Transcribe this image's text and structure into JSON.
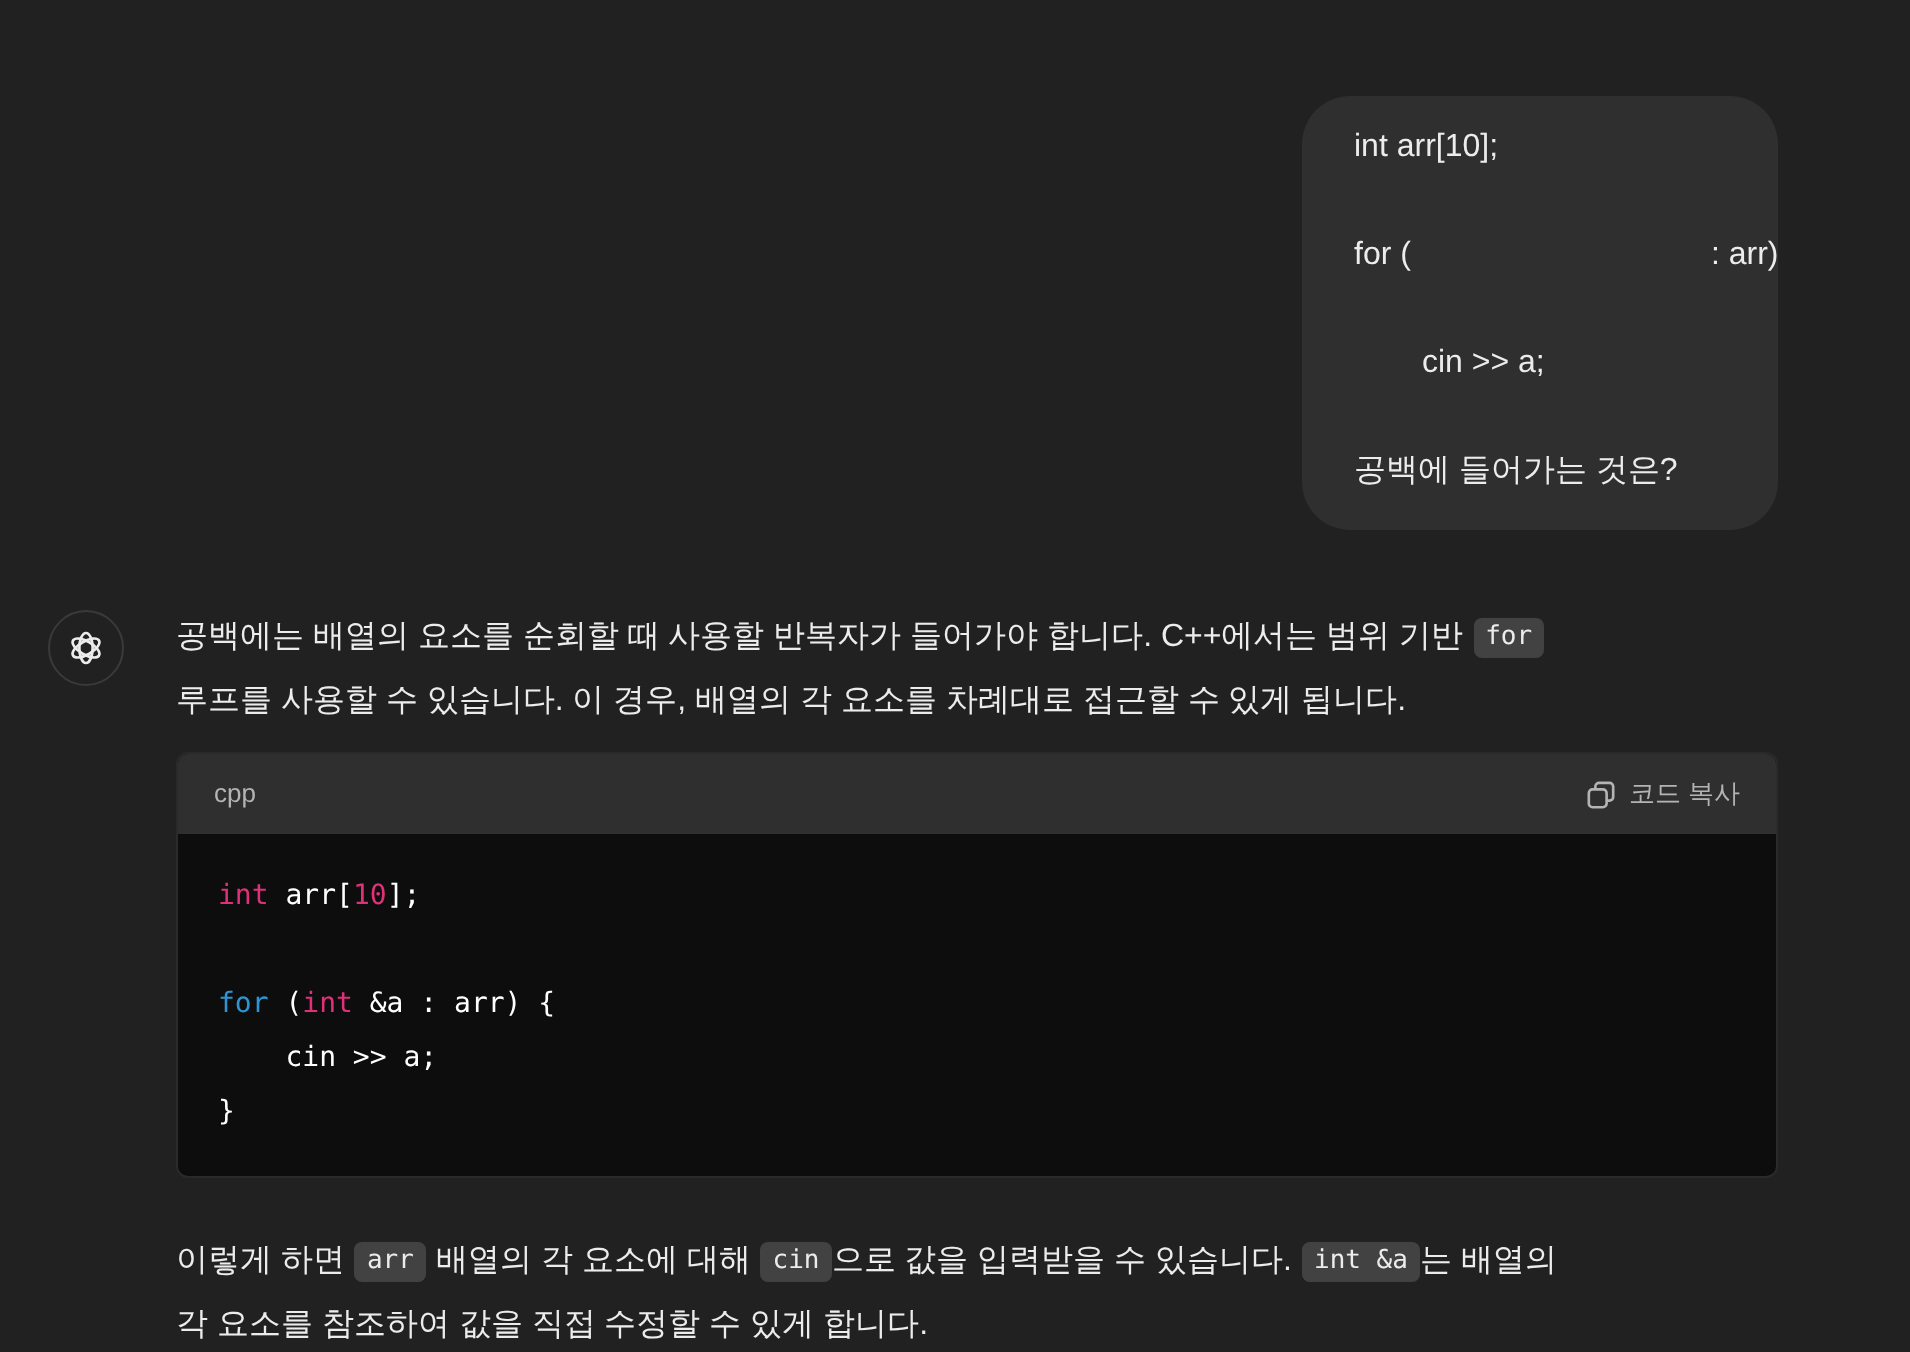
{
  "user_message": {
    "lines": [
      {
        "parts": [
          "int arr[10];"
        ],
        "indented": false
      },
      {
        "parts": [
          "for (",
          ": arr)"
        ],
        "indented": false
      },
      {
        "parts": [
          "cin >> a;"
        ],
        "indented": true
      },
      {
        "parts": [
          "공백에 들어가는 것은?"
        ],
        "indented": false
      }
    ]
  },
  "assistant_message": {
    "paragraphs_before": [
      [
        [
          {
            "kind": "text",
            "text": "공백에는 배열의 요소를 순회할 때 사용할 반복자가 들어가야 합니다. C++에서는 범위 기반"
          },
          {
            "kind": "code",
            "text": "for"
          }
        ],
        [
          {
            "kind": "text",
            "text": "루프를 사용할 수 있습니다. 이 경우, 배열의 각 요소를 차례대로 접근할 수 있게 됩니다."
          }
        ]
      ]
    ],
    "code_block": {
      "language": "cpp",
      "copy_label": "코드 복사",
      "lines": [
        {
          "blank_after": true,
          "tokens": [
            {
              "kind": "keyword",
              "text": "int"
            },
            {
              "kind": "plain",
              "text": " arr["
            },
            {
              "kind": "number",
              "text": "10"
            },
            {
              "kind": "plain",
              "text": "];"
            }
          ]
        },
        {
          "blank_after": false,
          "tokens": [
            {
              "kind": "control",
              "text": "for"
            },
            {
              "kind": "plain",
              "text": " ("
            },
            {
              "kind": "keyword",
              "text": "int"
            },
            {
              "kind": "plain",
              "text": " &a : arr) {"
            }
          ]
        },
        {
          "blank_after": false,
          "tokens": [
            {
              "kind": "plain",
              "text": "    cin >> a;"
            }
          ]
        },
        {
          "blank_after": false,
          "tokens": [
            {
              "kind": "plain",
              "text": "}"
            }
          ]
        }
      ]
    },
    "paragraphs_after": [
      [
        [
          {
            "kind": "text",
            "text": "이렇게 하면"
          },
          {
            "kind": "code",
            "text": "arr",
            "attached": false
          },
          {
            "kind": "text",
            "text": "배열의 각 요소에 대해"
          },
          {
            "kind": "code",
            "text": "cin",
            "attached": true
          },
          {
            "kind": "text",
            "text": "으로 값을 입력받을 수 있습니다."
          },
          {
            "kind": "code",
            "text": "int &a",
            "attached": true
          },
          {
            "kind": "text",
            "text": "는 배열의"
          }
        ],
        [
          {
            "kind": "text",
            "text": "각 요소를 참조하여 값을 직접 수정할 수 있게 합니다."
          }
        ]
      ]
    ]
  }
}
